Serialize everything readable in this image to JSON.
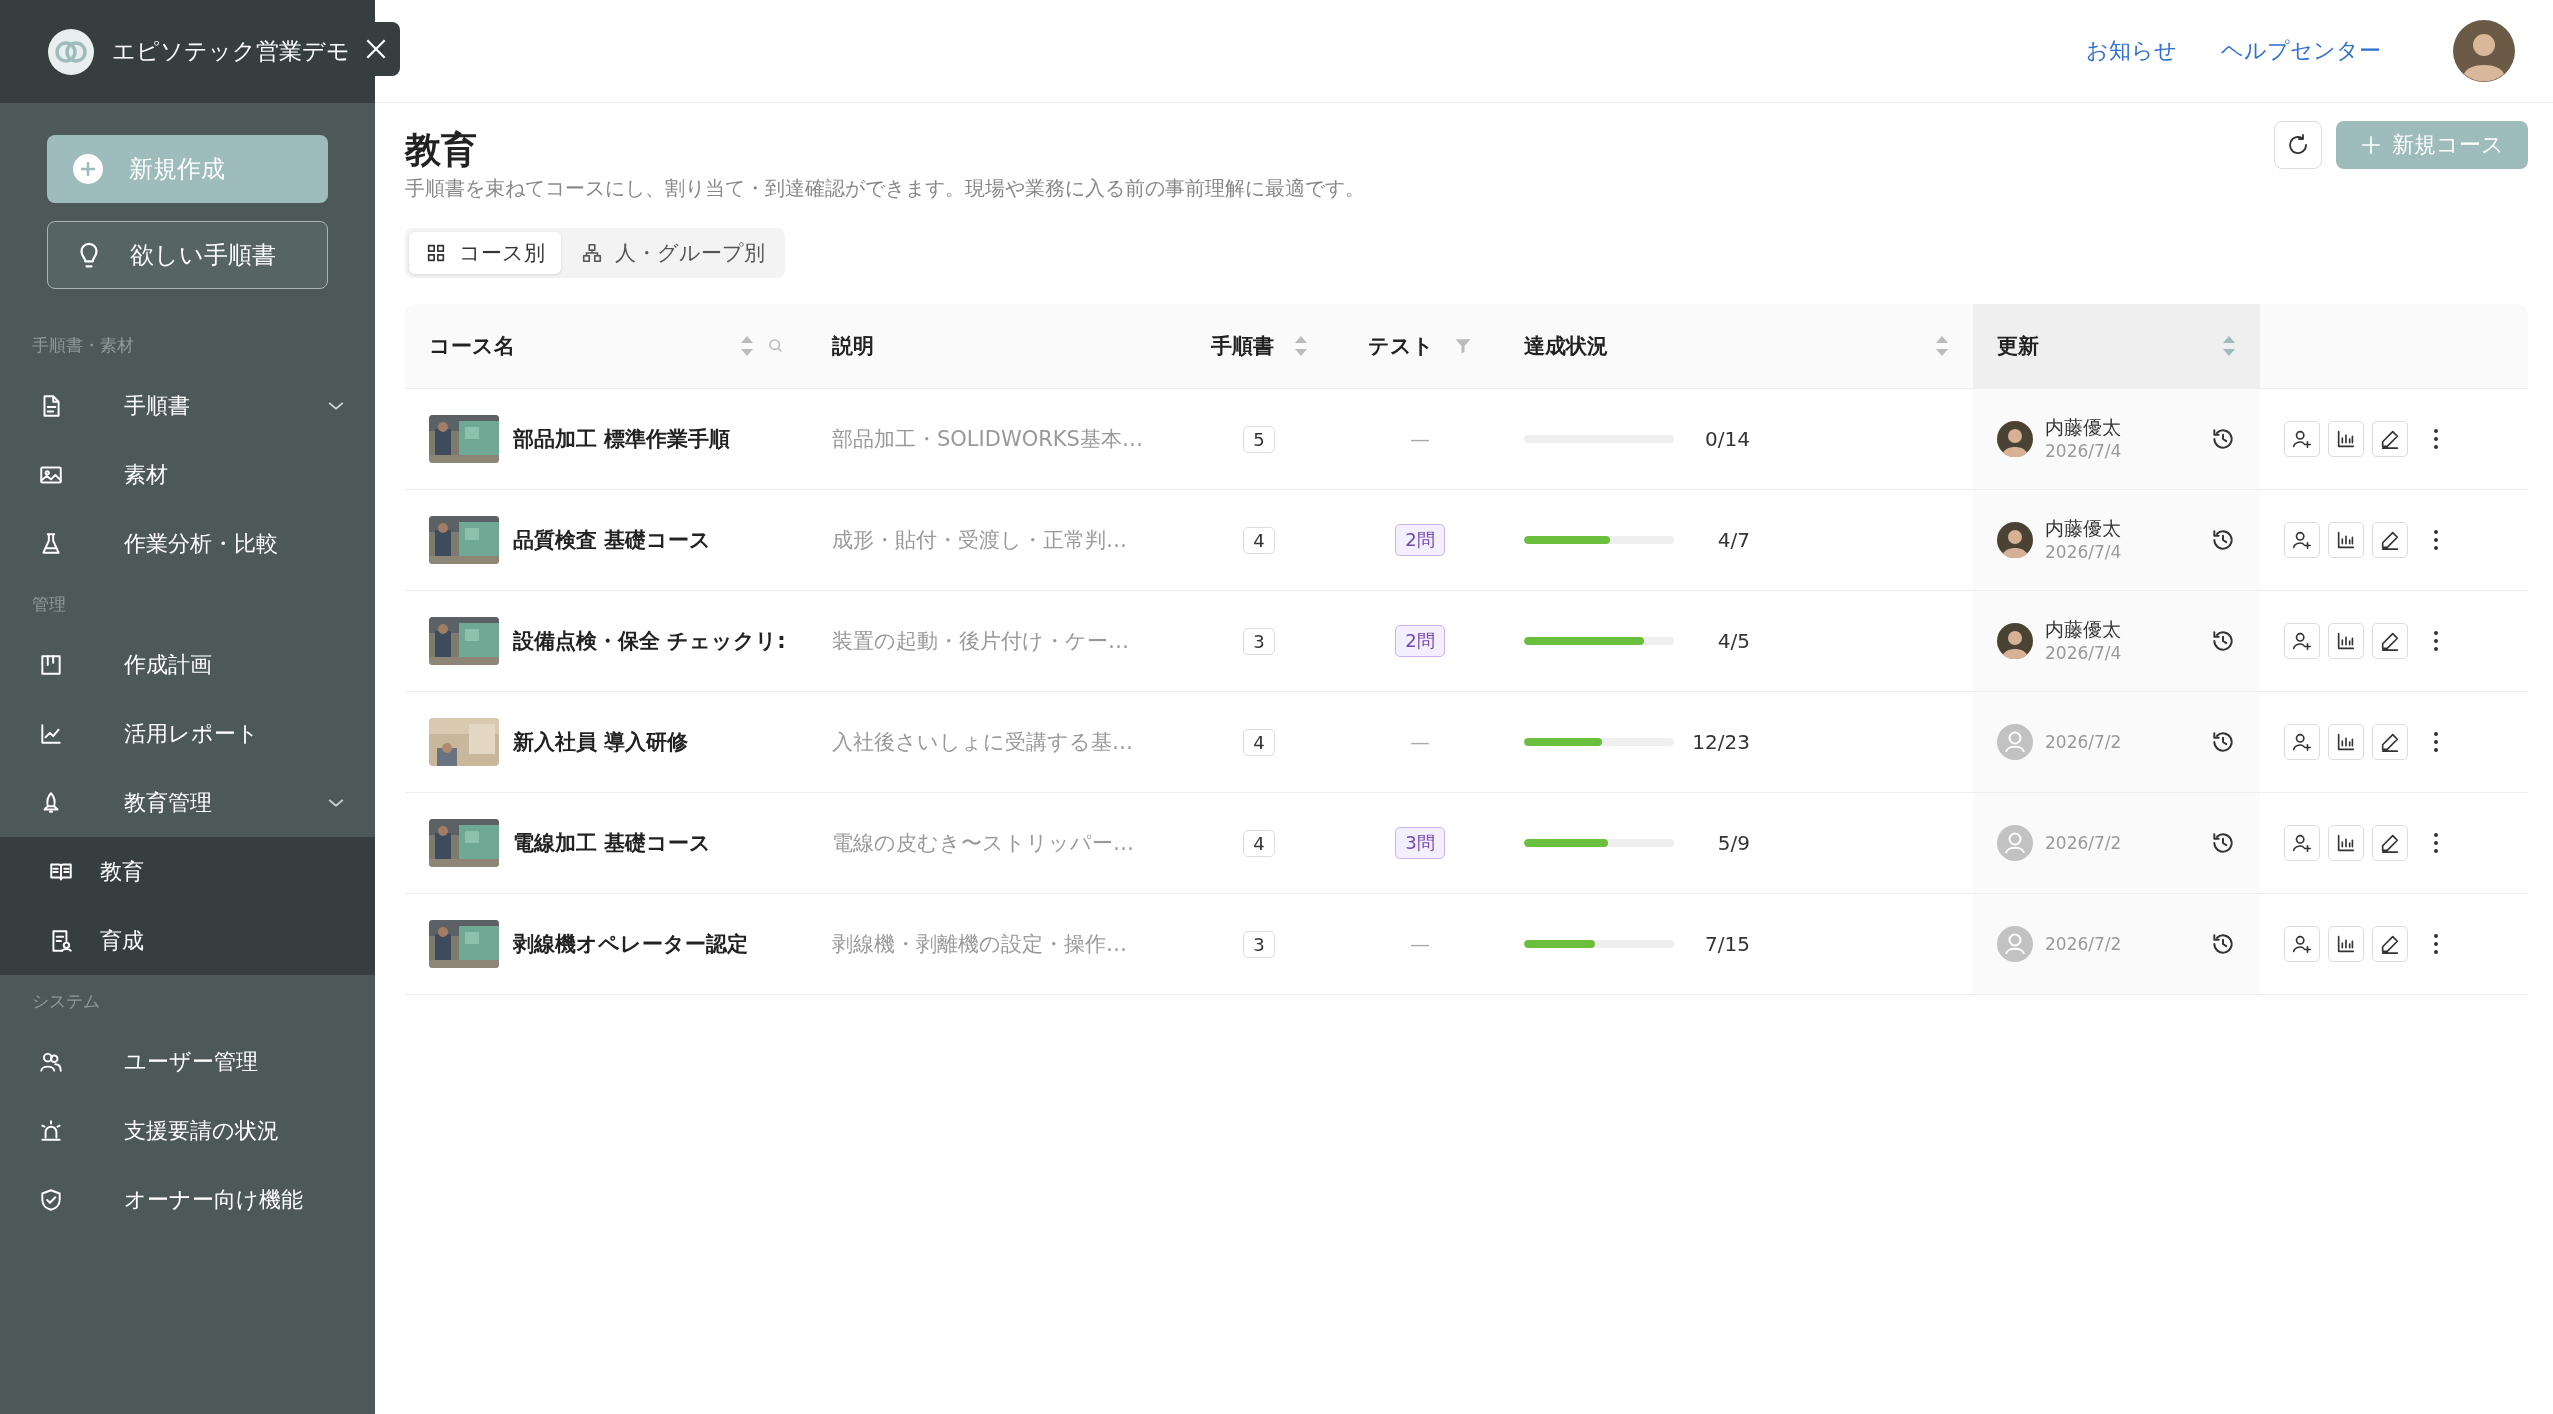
{
  "app": {
    "name": "エピソテック営業デモ"
  },
  "sidebar": {
    "buttons": [
      {
        "kind": "primary",
        "label": "新規作成"
      },
      {
        "kind": "outline",
        "label": "欲しい手順書"
      }
    ],
    "sections": [
      {
        "title": "手順書・素材",
        "items": [
          {
            "label": "手順書",
            "expandable": true
          },
          {
            "label": "素材",
            "expandable": false
          },
          {
            "label": "作業分析・比較",
            "expandable": false
          }
        ]
      },
      {
        "title": "管理",
        "items": [
          {
            "label": "作成計画",
            "expandable": false
          },
          {
            "label": "活用レポート",
            "expandable": false
          },
          {
            "label": "教育管理",
            "expandable": true,
            "children": [
              {
                "label": "教育"
              },
              {
                "label": "育成"
              }
            ]
          }
        ]
      },
      {
        "title": "システム",
        "items": [
          {
            "label": "ユーザー管理",
            "expandable": false
          },
          {
            "label": "支援要請の状況",
            "expandable": false
          },
          {
            "label": "オーナー向け機能",
            "expandable": false
          }
        ]
      }
    ]
  },
  "header": {
    "links": [
      "お知らせ",
      "ヘルプセンター"
    ]
  },
  "page": {
    "title": "教育",
    "description": "手順書を束ねてコースにし、割り当て・到達確認ができます。現場や業務に入る前の事前理解に最適です。",
    "new_button": "新規コース",
    "view_tabs": [
      {
        "label": "コース別",
        "selected": true
      },
      {
        "label": "人・グループ別",
        "selected": false
      }
    ]
  },
  "table": {
    "columns": [
      {
        "label": "コース名",
        "sortable": true,
        "searchable": true,
        "filterable": false,
        "active": false
      },
      {
        "label": "説明",
        "sortable": false,
        "searchable": false,
        "filterable": false,
        "active": false
      },
      {
        "label": "手順書",
        "sortable": true,
        "searchable": false,
        "filterable": false,
        "active": false
      },
      {
        "label": "テスト",
        "sortable": false,
        "searchable": false,
        "filterable": true,
        "active": false
      },
      {
        "label": "達成状況",
        "sortable": true,
        "searchable": false,
        "filterable": false,
        "active": false
      },
      {
        "label": "更新",
        "sortable": true,
        "searchable": false,
        "filterable": false,
        "active": true
      }
    ],
    "rows": [
      {
        "name": "部品加工 標準作業手順",
        "description": "部品加工・SOLIDWORKS基本…",
        "steps": "5",
        "test": {
          "kind": "none",
          "label": "—"
        },
        "progress": "0/14",
        "updater": {
          "name": "内藤優太"
        },
        "date": "2026/7/4"
      },
      {
        "name": "品質検査 基礎コース",
        "description": "成形・貼付・受渡し・正常判…",
        "steps": "4",
        "test": {
          "kind": "badge",
          "label": "2問"
        },
        "progress": "4/7",
        "level": 0.57,
        "updater": {
          "name": "内藤優太"
        },
        "date": "2026/7/4"
      },
      {
        "name": "設備点検・保全 チェックリ:",
        "description": "装置の起動・後片付け・ケー…",
        "steps": "3",
        "test": {
          "kind": "badge",
          "label": "2問"
        },
        "progress": "4/5",
        "level": 0.8,
        "updater": {
          "name": "内藤優太"
        },
        "date": "2026/7/4"
      },
      {
        "name": "新入社員 導入研修",
        "description": "入社後さいしょに受講する基…",
        "steps": "4",
        "test": {
          "kind": "none",
          "label": "—"
        },
        "progress": "12/23",
        "level": 0.52,
        "date": "2026/7/2"
      },
      {
        "name": "電線加工 基礎コース",
        "description": "電線の皮むき〜ストリッパー…",
        "steps": "4",
        "test": {
          "kind": "badge",
          "label": "3問"
        },
        "progress": "5/9",
        "level": 0.56,
        "date": "2026/7/2"
      },
      {
        "name": "剥線機オペレーター認定",
        "description": "剥線機・剥離機の設定・操作…",
        "steps": "3",
        "test": {
          "kind": "none",
          "label": "—"
        },
        "progress": "7/15",
        "level": 0.47,
        "date": "2026/7/2"
      }
    ]
  }
}
